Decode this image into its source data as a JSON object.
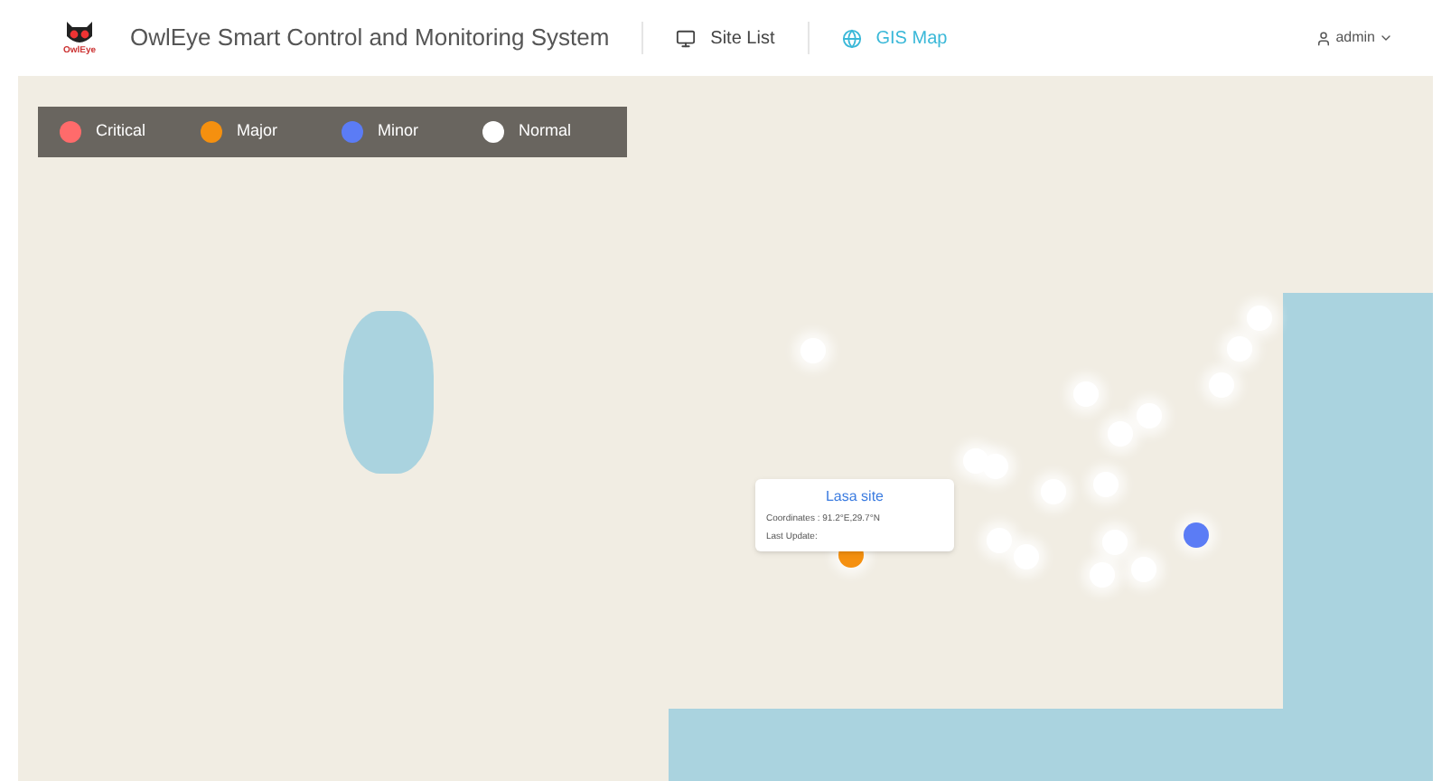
{
  "header": {
    "logo_text": "OwlEye",
    "title": "OwlEye Smart Control and Monitoring System",
    "nav": [
      {
        "label": "Site List",
        "kind": "list",
        "selected": false
      },
      {
        "label": "GIS Map",
        "kind": "globe",
        "selected": true
      }
    ],
    "user": "admin"
  },
  "legend": [
    {
      "label": "Critical",
      "color": "#ff6b6b"
    },
    {
      "label": "Major",
      "color": "#f5900f"
    },
    {
      "label": "Minor",
      "color": "#5b7cf5"
    },
    {
      "label": "Normal",
      "color": "#ffffff"
    }
  ],
  "popup": {
    "title": "Lasa site",
    "coordinates": "Coordinates : 91.2°E,29.7°N",
    "last_update": "Last Update:"
  },
  "markers": [
    {
      "color": "#f5900f"
    },
    {
      "color": "#5b7cf5"
    },
    {
      "color": "#ffffff"
    },
    {
      "color": "#ffffff"
    },
    {
      "color": "#ffffff"
    },
    {
      "color": "#ffffff"
    },
    {
      "color": "#ffffff"
    },
    {
      "color": "#ffffff"
    },
    {
      "color": "#ffffff"
    },
    {
      "color": "#ffffff"
    },
    {
      "color": "#ffffff"
    },
    {
      "color": "#ffffff"
    },
    {
      "color": "#ffffff"
    },
    {
      "color": "#ffffff"
    },
    {
      "color": "#ffffff"
    },
    {
      "color": "#ffffff"
    },
    {
      "color": "#ffffff"
    },
    {
      "color": "#ffffff"
    }
  ]
}
